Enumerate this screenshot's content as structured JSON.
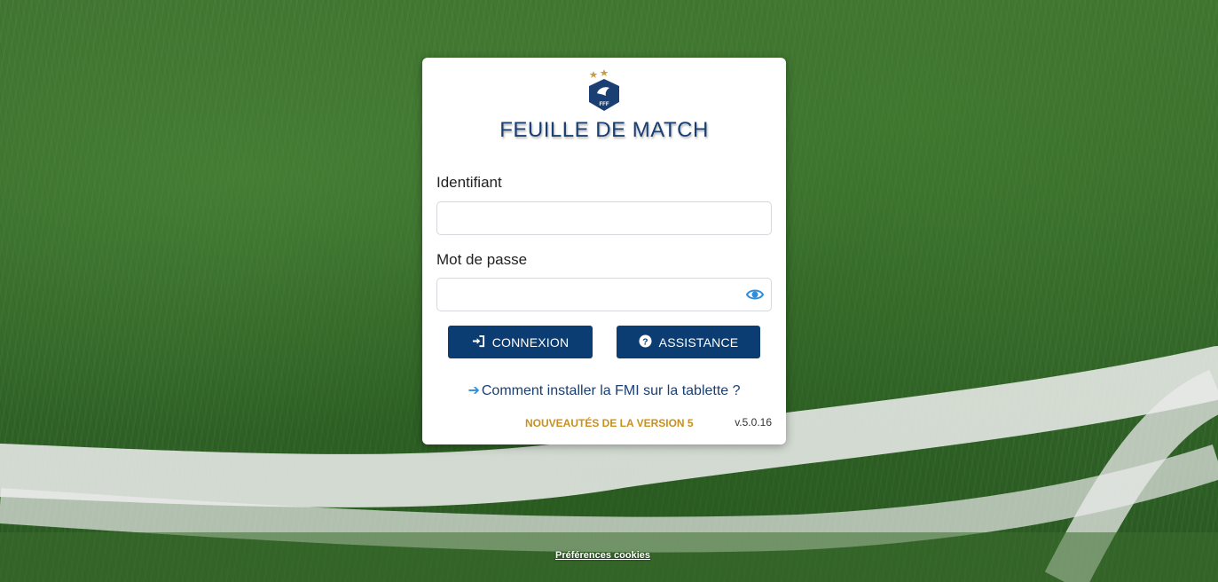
{
  "brand": {
    "logo_icon": "fff-rooster-crest-icon",
    "primary_color": "#0c3d72",
    "accent_color": "#c8901e",
    "link_icon_color": "#2d8fdc"
  },
  "login": {
    "title": "FEUILLE DE MATCH",
    "username_label": "Identifiant",
    "username_value": "",
    "password_label": "Mot de passe",
    "password_value": "",
    "password_toggle_icon": "eye-icon",
    "connexion_button": {
      "label": "CONNEXION",
      "icon": "sign-in-icon"
    },
    "assistance_button": {
      "label": "ASSISTANCE",
      "icon": "question-circle-icon"
    },
    "install_link": {
      "icon": "arrow-right-icon",
      "label": "Comment installer la FMI sur la tablette ?"
    },
    "news_link": "NOUVEAUTÉS DE LA VERSION 5",
    "version": "v.5.0.16"
  },
  "footer": {
    "cookies_link": "Préférences cookies"
  }
}
